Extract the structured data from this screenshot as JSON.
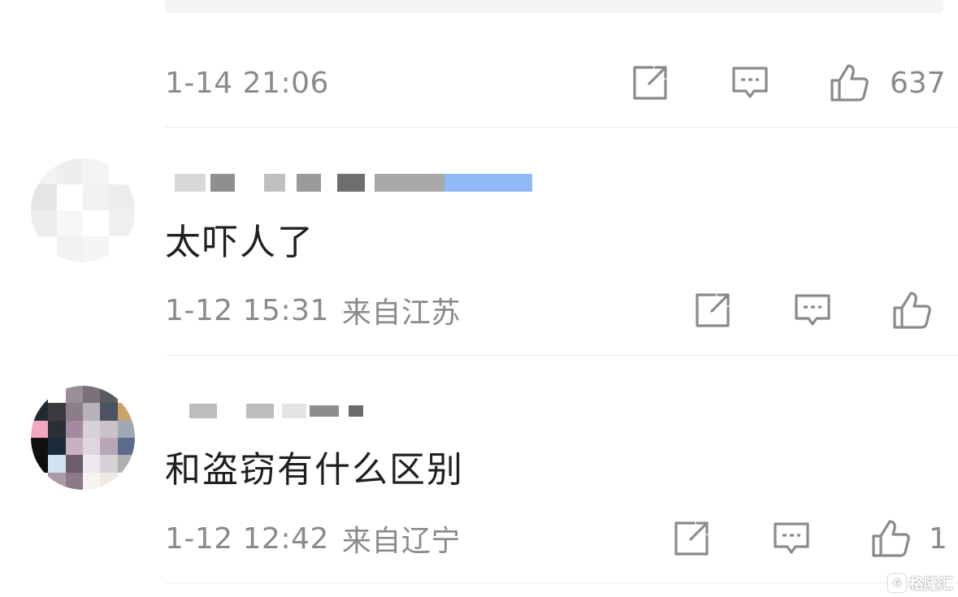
{
  "comments": [
    {
      "timestamp": "1-14 21:06",
      "location": "",
      "like_count": "637"
    },
    {
      "username": "",
      "text": "太吓人了",
      "timestamp": "1-12 15:31",
      "location": "来自江苏",
      "like_count": ""
    },
    {
      "username": "",
      "text": "和盗窃有什么区别",
      "timestamp": "1-12 12:42",
      "location": "来自辽宁",
      "like_count": "1"
    }
  ],
  "icons": {
    "share": "share-icon",
    "reply": "comment-icon",
    "like": "thumbs-up-icon"
  },
  "watermark": {
    "text": "格隆汇"
  },
  "colors": {
    "meta_text": "#8a8a8a",
    "comment_text": "#1f1f1f",
    "divider": "#ececec",
    "icon_stroke": "#8a8a8a"
  }
}
